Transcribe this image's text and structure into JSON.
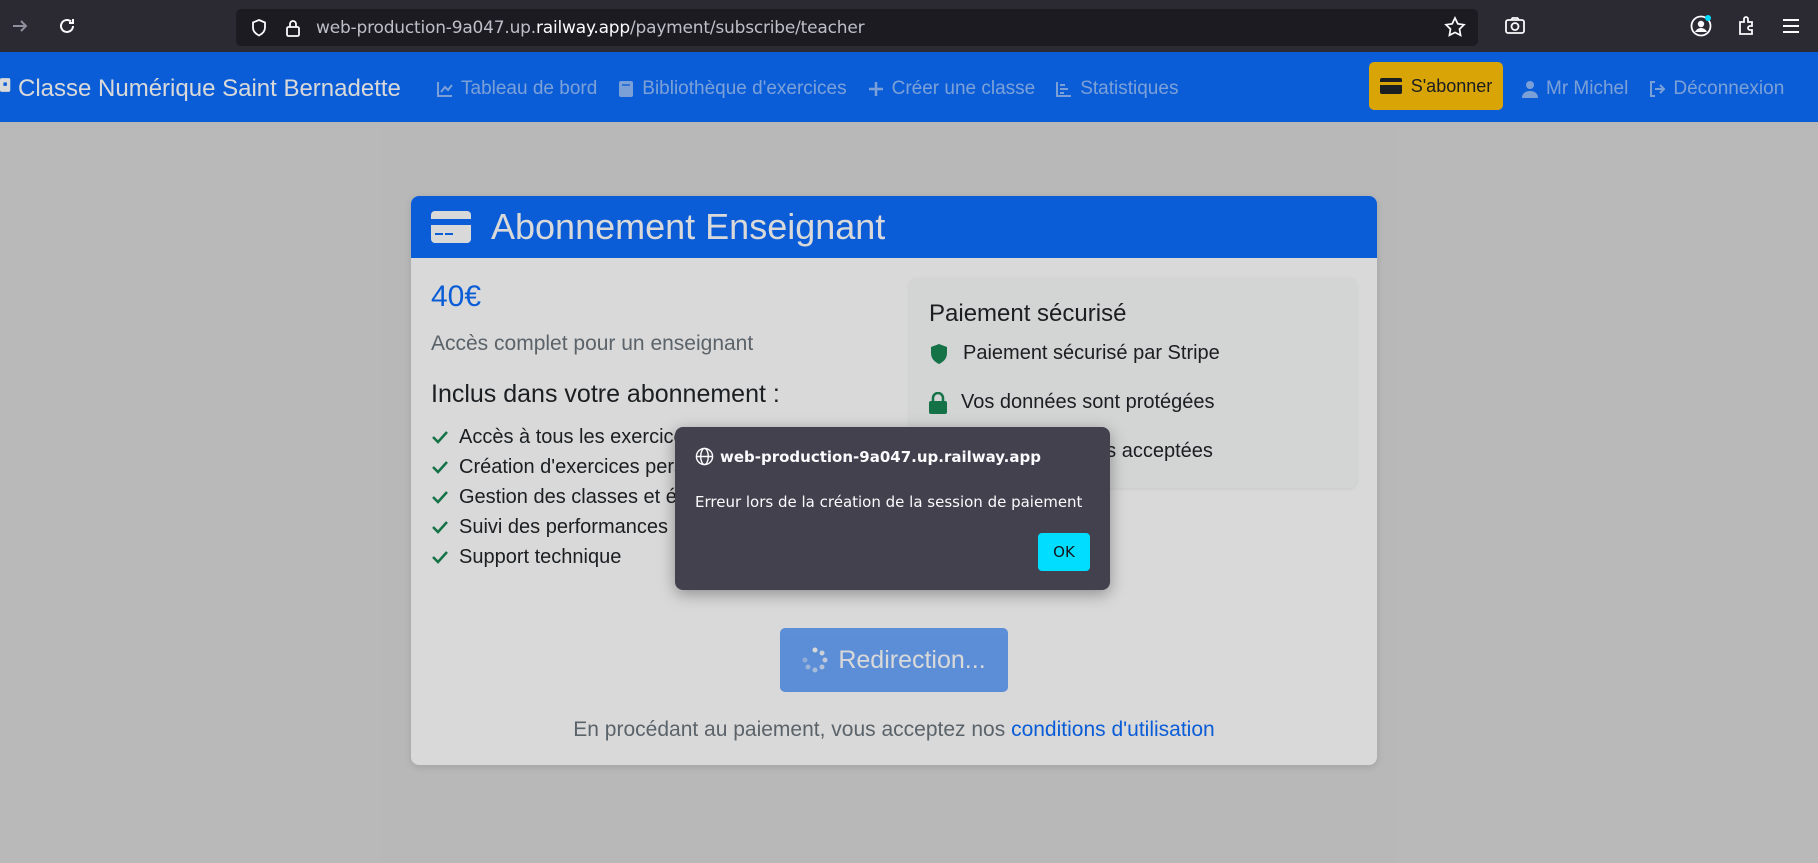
{
  "browser": {
    "url_prefix": "web-production-9a047.up.",
    "url_domain": "railway.app",
    "url_path": "/payment/subscribe/teacher"
  },
  "nav": {
    "brand": "Classe Numérique Saint Bernadette",
    "links": [
      {
        "label": "Tableau de bord",
        "icon": "chart-line-icon"
      },
      {
        "label": "Bibliothèque d'exercices",
        "icon": "book-icon"
      },
      {
        "label": "Créer une classe",
        "icon": "plus-icon"
      },
      {
        "label": "Statistiques",
        "icon": "bar-chart-icon"
      }
    ],
    "subscribe": "S'abonner",
    "user": "Mr Michel",
    "logout": "Déconnexion"
  },
  "card": {
    "title": "Abonnement Enseignant",
    "price": "40€",
    "price_sub": "Accès complet pour un enseignant",
    "included_title": "Inclus dans votre abonnement :",
    "features": [
      "Accès à tous les exercices",
      "Création d'exercices personnalisés",
      "Gestion des classes et élèves",
      "Suivi des performances",
      "Support technique"
    ],
    "secure_title": "Paiement sécurisé",
    "secure_items": [
      "Paiement sécurisé par Stripe",
      "Vos données sont protégées",
      "Cartes bancaires acceptées"
    ],
    "redirect_button": "Redirection...",
    "terms_prefix": "En procédant au paiement, vous acceptez nos",
    "terms_link": "conditions d'utilisation"
  },
  "modal": {
    "origin": "web-production-9a047.up.railway.app",
    "message": "Erreur lors de la création de la session de paiement",
    "ok": "OK"
  },
  "colors": {
    "primary": "#0d6efd",
    "warning": "#ffc107",
    "success": "#198754",
    "modal_button": "#00ddff"
  }
}
